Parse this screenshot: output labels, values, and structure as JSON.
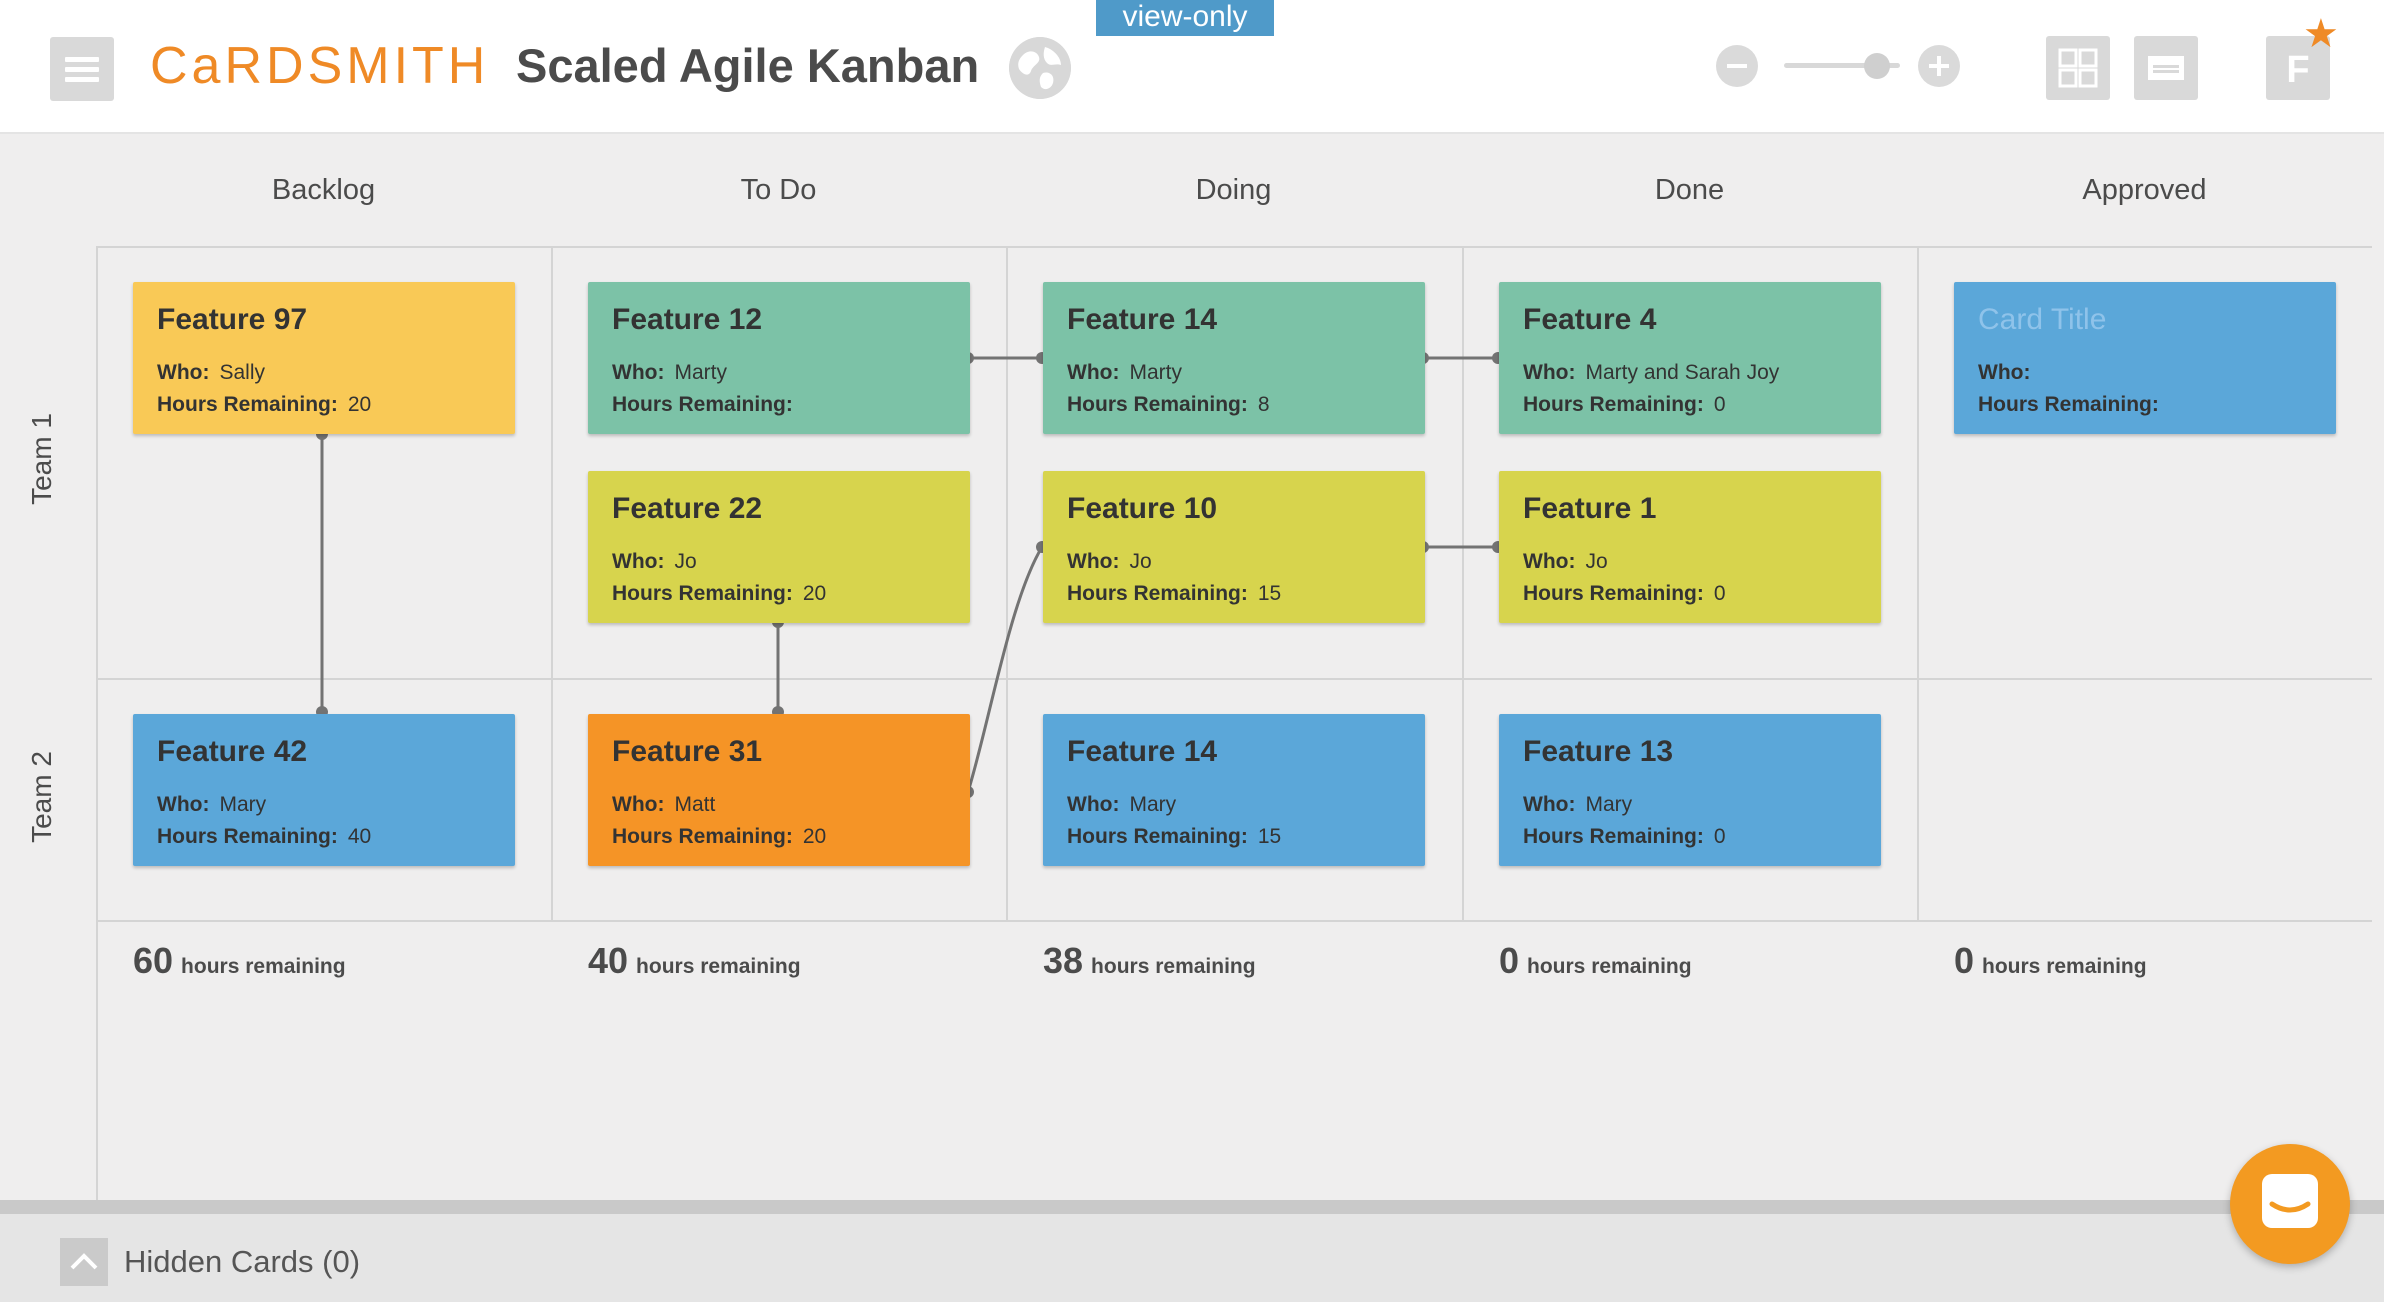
{
  "header": {
    "logo": "CaRDSMITH",
    "board_title": "Scaled Agile Kanban",
    "view_only": "view-only",
    "profile_initial": "F"
  },
  "columns": [
    "Backlog",
    "To Do",
    "Doing",
    "Done",
    "Approved"
  ],
  "rows": [
    "Team 1",
    "Team 2"
  ],
  "cards": {
    "f97": {
      "title": "Feature 97",
      "who_label": "Who:",
      "who": "Sally",
      "hours_label": "Hours Remaining:",
      "hours": "20"
    },
    "f12": {
      "title": "Feature 12",
      "who_label": "Who:",
      "who": "Marty",
      "hours_label": "Hours Remaining:",
      "hours": ""
    },
    "f14a": {
      "title": "Feature 14",
      "who_label": "Who:",
      "who": "Marty",
      "hours_label": "Hours Remaining:",
      "hours": "8"
    },
    "f4": {
      "title": "Feature 4",
      "who_label": "Who:",
      "who": "Marty and Sarah Joy",
      "hours_label": "Hours Remaining:",
      "hours": "0"
    },
    "ct": {
      "title": "Card Title",
      "who_label": "Who:",
      "who": "",
      "hours_label": "Hours Remaining:",
      "hours": ""
    },
    "f22": {
      "title": "Feature 22",
      "who_label": "Who:",
      "who": "Jo",
      "hours_label": "Hours Remaining:",
      "hours": "20"
    },
    "f10": {
      "title": "Feature 10",
      "who_label": "Who:",
      "who": "Jo",
      "hours_label": "Hours Remaining:",
      "hours": "15"
    },
    "f1": {
      "title": "Feature 1",
      "who_label": "Who:",
      "who": "Jo",
      "hours_label": "Hours Remaining:",
      "hours": "0"
    },
    "f42": {
      "title": "Feature 42",
      "who_label": "Who:",
      "who": "Mary",
      "hours_label": "Hours Remaining:",
      "hours": "40"
    },
    "f31": {
      "title": "Feature 31",
      "who_label": "Who:",
      "who": "Matt",
      "hours_label": "Hours Remaining:",
      "hours": "20"
    },
    "f14b": {
      "title": "Feature 14",
      "who_label": "Who:",
      "who": "Mary",
      "hours_label": "Hours Remaining:",
      "hours": "15"
    },
    "f13": {
      "title": "Feature 13",
      "who_label": "Who:",
      "who": "Mary",
      "hours_label": "Hours Remaining:",
      "hours": "0"
    }
  },
  "totals": [
    {
      "value": "60",
      "label": "hours remaining"
    },
    {
      "value": "40",
      "label": "hours remaining"
    },
    {
      "value": "38",
      "label": "hours remaining"
    },
    {
      "value": "0",
      "label": "hours remaining"
    },
    {
      "value": "0",
      "label": "hours remaining"
    }
  ],
  "footer": {
    "hidden_cards": "Hidden Cards (0)"
  },
  "colors": {
    "brand": "#ef8a26",
    "yellow": "#f9c956",
    "green": "#7cc2a7",
    "lime": "#d7d44d",
    "blue": "#5ba7d9",
    "orange": "#f59426"
  },
  "icons": {
    "menu": "hamburger-menu-icon",
    "globe": "globe-icon",
    "zoom_out": "minus-icon",
    "zoom_in": "plus-icon",
    "grid": "grid-view-icon",
    "card": "card-view-icon",
    "star": "star-icon",
    "chat": "chat-icon",
    "hidden_toggle": "chevron-up-icon"
  }
}
